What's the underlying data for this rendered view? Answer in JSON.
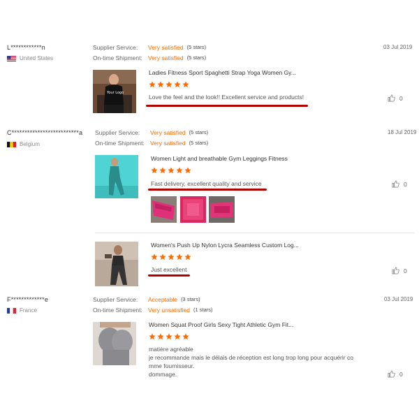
{
  "reviews": [
    {
      "buyer": "L************n",
      "country": "United States",
      "supplier_label": "Supplier Service:",
      "supplier_value": "Very satisfied",
      "supplier_stars": "(5 stars)",
      "shipment_label": "On-time Shipment:",
      "shipment_value": "Very satisfied",
      "shipment_stars": "(5 stars)",
      "date": "03 Jul 2019",
      "product": "Ladies Fitness Sport Spaghetti Strap Yoga Women Gy...",
      "rating": 5,
      "text": "Love the feel and the look!!  Excellent service and products!",
      "likes": "0",
      "thumb_caption": "Your Logo"
    },
    {
      "buyer": "C**************************a",
      "country": "Belgium",
      "supplier_label": "Supplier Service:",
      "supplier_value": "Very satisfied",
      "supplier_stars": "(5 stars)",
      "shipment_label": "On-time Shipment:",
      "shipment_value": "Very satisfied",
      "shipment_stars": "(5 stars)",
      "date": "18 Jul 2019",
      "product": "Women Light and breathable Gym Leggings Fitness",
      "rating": 5,
      "text": "Fast delivery, excellent quality and service",
      "likes": "0",
      "second_item": {
        "product": "Women's Push Up Nylon Lycra Seamless Custom Log...",
        "rating": 5,
        "text": "Just excellent",
        "likes": "0"
      }
    },
    {
      "buyer": "F*************e",
      "country": "France",
      "supplier_label": "Supplier Service:",
      "supplier_value": "Acceptable",
      "supplier_stars": "(3 stars)",
      "shipment_label": "On-time Shipment:",
      "shipment_value": "Very unsatisfied",
      "shipment_stars": "(1 stars)",
      "date": "03 Jul 2019",
      "product": "Women Squat Proof Girls Sexy Tight Athletic Gym Fit...",
      "rating": 5,
      "text_lines": [
        "matière agréable",
        "je recommande mais le délais de réception est long trop long pour acquérir co",
        "mme fournisseur.",
        "dommage."
      ],
      "likes": "0"
    }
  ],
  "colors": {
    "accent": "#ff6a00",
    "annotation_underline": "#b00000"
  },
  "icons": [
    "us-flag-icon",
    "belgium-flag-icon",
    "france-flag-icon",
    "star-icon",
    "thumbs-up-icon"
  ]
}
